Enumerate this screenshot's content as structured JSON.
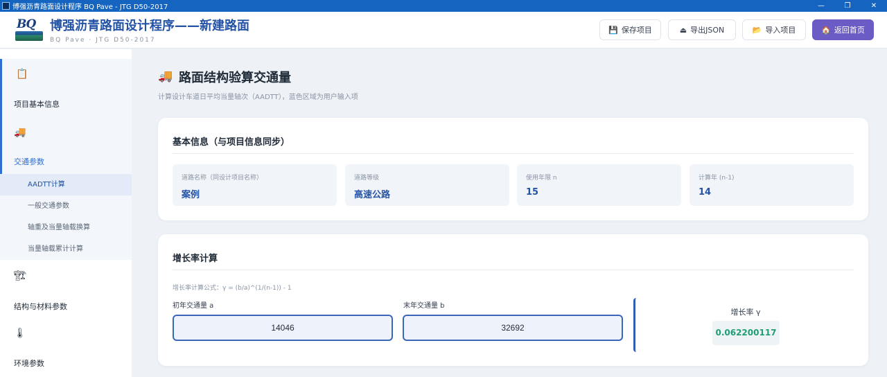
{
  "window": {
    "title": "博强沥青路面设计程序 BQ Pave - JTG D50-2017",
    "minimize": "—",
    "restore": "❐",
    "close": "✕"
  },
  "header": {
    "logo_text": "BQ",
    "title": "博强沥青路面设计程序——新建路面",
    "subtitle": "BQ Pave · JTG D50-2017",
    "buttons": [
      {
        "label": "保存项目",
        "icon": "save-icon",
        "glyph": "💾"
      },
      {
        "label": "导出JSON",
        "icon": "export-icon",
        "glyph": "⏏"
      },
      {
        "label": "导入项目",
        "icon": "folder-icon",
        "glyph": "📂"
      },
      {
        "label": "返回首页",
        "icon": "home-icon",
        "glyph": "🏠"
      }
    ],
    "colors": {
      "title": "#2453a6",
      "primary_button": "#6b5bc4"
    }
  },
  "sidebar": {
    "groups": [
      {
        "label": "项目基本信息",
        "icon": "clipboard-icon",
        "glyph": "📋"
      },
      {
        "label": "交通参数",
        "icon": "truck-icon",
        "glyph": "🚚",
        "items": [
          {
            "label": "AADTT计算"
          },
          {
            "label": "一般交通参数"
          },
          {
            "label": "轴重及当量轴载换算"
          },
          {
            "label": "当量轴载累计计算"
          }
        ]
      },
      {
        "label": "结构与材料参数",
        "icon": "layers-icon",
        "glyph": "🏗"
      },
      {
        "label": "环境参数",
        "icon": "thermometer-icon",
        "glyph": "🌡"
      }
    ],
    "active_group": "交通参数",
    "selected_item": "AADTT计算"
  },
  "main": {
    "title": "路面结构验算交通量",
    "title_icon": "truck-icon",
    "title_glyph": "🚚",
    "description": "计算设计车道日平均当量轴次（AADTT），蓝色区域为用户输入项",
    "basic_info": {
      "title": "基本信息（与项目信息同步）",
      "fields": [
        {
          "label": "道路名称（同设计项目名称）",
          "value": "案例"
        },
        {
          "label": "道路等级",
          "value": "高速公路"
        },
        {
          "label": "使用年限 n",
          "value": "15"
        },
        {
          "label": "计算年 (n-1)",
          "value": "14"
        }
      ]
    },
    "growth": {
      "title": "增长率计算",
      "formula": "增长率计算公式：γ = (b/a)^(1/(n-1)) - 1",
      "initial_label": "初年交通量 a",
      "initial_value": "14046",
      "final_label": "末年交通量 b",
      "final_value": "32692",
      "result_label": "增长率 γ",
      "result_value": "0.062200117"
    }
  }
}
